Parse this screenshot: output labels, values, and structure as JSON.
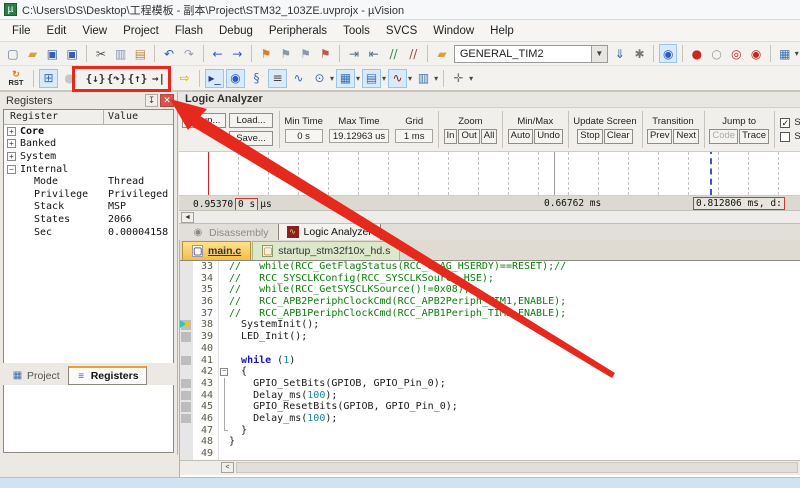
{
  "window": {
    "title": "C:\\Users\\DS\\Desktop\\工程模板 - 副本\\Project\\STM32_103ZE.uvprojx - µVision"
  },
  "menu": {
    "items": [
      "File",
      "Edit",
      "View",
      "Project",
      "Flash",
      "Debug",
      "Peripherals",
      "Tools",
      "SVCS",
      "Window",
      "Help"
    ]
  },
  "toolbar1": {
    "target_combo_value": "GENERAL_TIM2",
    "icons_a": [
      {
        "n": "new-file-icon",
        "g": "▢",
        "c": "#60789a"
      },
      {
        "n": "open-folder-icon",
        "g": "▰",
        "c": "#d9a33c"
      },
      {
        "n": "save-icon",
        "g": "▣",
        "c": "#3a5fae"
      },
      {
        "n": "save-all-icon",
        "g": "▣",
        "c": "#3a5fae",
        "sep": true
      },
      {
        "n": "cut-icon",
        "g": "✂",
        "c": "#555555"
      },
      {
        "n": "copy-icon",
        "g": "▥",
        "c": "#8a93b8"
      },
      {
        "n": "paste-icon",
        "g": "▤",
        "c": "#b08d4e",
        "sep": true
      },
      {
        "n": "undo-icon",
        "g": "↶",
        "c": "#2f58c8"
      },
      {
        "n": "redo-icon",
        "g": "↷",
        "c": "#98a0b0",
        "sep": true
      },
      {
        "n": "navigate-back-icon",
        "g": "←",
        "c": "#2f58c8"
      },
      {
        "n": "navigate-forward-icon",
        "g": "→",
        "c": "#2f58c8",
        "sep": true
      },
      {
        "n": "bookmark-icon",
        "g": "⚑",
        "c": "#e07a1e"
      },
      {
        "n": "bookmark-next-icon",
        "g": "⚑",
        "c": "#8a99aa"
      },
      {
        "n": "bookmark-prev-icon",
        "g": "⚑",
        "c": "#8a99aa"
      },
      {
        "n": "bookmark-clear-icon",
        "g": "⚑",
        "c": "#b85a4a",
        "sep": true
      },
      {
        "n": "indent-icon",
        "g": "⇥",
        "c": "#4a6a8a"
      },
      {
        "n": "outdent-icon",
        "g": "⇤",
        "c": "#4a6a8a"
      },
      {
        "n": "comment-icon",
        "g": "//",
        "c": "#3a8a4a"
      },
      {
        "n": "uncomment-icon",
        "g": "//",
        "c": "#a04a4a",
        "sep": true
      },
      {
        "n": "target-folder-icon",
        "g": "▰",
        "c": "#d9a33c"
      }
    ],
    "icons_b": [
      {
        "n": "flash-download-icon",
        "g": "⇓",
        "c": "#365f9e"
      },
      {
        "n": "target-options-icon",
        "g": "✱",
        "c": "#777777",
        "sep": true
      },
      {
        "n": "find-in-files-icon",
        "g": "◉",
        "c": "#2f58c8",
        "boxed": true,
        "sep": true
      },
      {
        "n": "breakpoint-icon",
        "g": "●",
        "c": "#c8281e"
      },
      {
        "n": "breakpoint-disabled-icon",
        "g": "○",
        "c": "#9a9a9a"
      },
      {
        "n": "kill-breakpoints-icon",
        "g": "◎",
        "c": "#c8281e"
      },
      {
        "n": "disable-breakpoints-icon",
        "g": "◉",
        "c": "#c8281e",
        "sep": true
      },
      {
        "n": "window-layout-icon",
        "g": "▦",
        "c": "#3a6fae",
        "caret": true
      }
    ]
  },
  "toolbar2": {
    "rst_label": "RST",
    "rst_glyph": "↻",
    "icons_pre": [
      {
        "n": "run-icon",
        "g": "⊞",
        "c": "#3a6fae",
        "boxed": true
      },
      {
        "n": "stop-icon",
        "g": "●",
        "c": "#aaaaaa",
        "disabled": true
      }
    ],
    "step_icons": [
      {
        "n": "step-into-icon",
        "g": "{↓}"
      },
      {
        "n": "step-over-icon",
        "g": "{↷}"
      },
      {
        "n": "step-out-icon",
        "g": "{↑}"
      },
      {
        "n": "run-to-cursor-icon",
        "g": "→|"
      }
    ],
    "next_statement": {
      "n": "show-next-statement-icon",
      "g": "⇨",
      "c": "#d8a800"
    },
    "icons_post": [
      {
        "n": "command-window-icon",
        "g": "▸_",
        "c": "#223a8a",
        "boxed": true
      },
      {
        "n": "disassembly-window-icon",
        "g": "◉",
        "c": "#2f58c8",
        "boxed": true
      },
      {
        "n": "symbols-window-icon",
        "g": "§",
        "c": "#3a6fae"
      },
      {
        "n": "registers-window-icon",
        "g": "≡",
        "c": "#444444",
        "boxed": true
      },
      {
        "n": "callstack-window-icon",
        "g": "∿",
        "c": "#3a6fae"
      },
      {
        "n": "watch-window-icon",
        "g": "⊙",
        "c": "#3a6fae",
        "caret": true
      },
      {
        "n": "memory-window-icon",
        "g": "▦",
        "c": "#3a6fae",
        "boxed": true,
        "caret": true
      },
      {
        "n": "serial-window-icon",
        "g": "▤",
        "c": "#3a6fae",
        "boxed": true,
        "caret": true
      },
      {
        "n": "analysis-window-icon",
        "g": "∿",
        "c": "#8a1f1f",
        "boxed": true,
        "caret": true
      },
      {
        "n": "system-viewer-icon",
        "g": "▥",
        "c": "#3a6fae",
        "caret": true,
        "sep": true
      },
      {
        "n": "toolbox-icon",
        "g": "✛",
        "c": "#777777",
        "caret": true
      }
    ]
  },
  "registers_panel": {
    "title": "Registers",
    "columns": [
      "Register",
      "Value"
    ],
    "rows": [
      {
        "label": "Core",
        "value": "",
        "level": 0,
        "expander": "+",
        "bold": true
      },
      {
        "label": "Banked",
        "value": "",
        "level": 0,
        "expander": "+"
      },
      {
        "label": "System",
        "value": "",
        "level": 0,
        "expander": "+"
      },
      {
        "label": "Internal",
        "value": "",
        "level": 0,
        "expander": "−"
      },
      {
        "label": "Mode",
        "value": "Thread",
        "level": 1
      },
      {
        "label": "Privilege",
        "value": "Privileged",
        "level": 1
      },
      {
        "label": "Stack",
        "value": "MSP",
        "level": 1
      },
      {
        "label": "States",
        "value": "2066",
        "level": 1
      },
      {
        "label": "Sec",
        "value": "0.00004158",
        "level": 1
      }
    ],
    "bottom_tabs": [
      {
        "label": "Project",
        "icon": "▦",
        "icon_color": "#3a6fae",
        "active": false
      },
      {
        "label": "Registers",
        "icon": "≡",
        "icon_color": "#3a6fae",
        "active": true
      }
    ]
  },
  "logic_analyzer": {
    "title": "Logic Analyzer",
    "file_buttons": [
      "Setup...",
      "Load...",
      "Save..."
    ],
    "value_groups": [
      {
        "label": "Min Time",
        "value": "0 s"
      },
      {
        "label": "Max Time",
        "value": "19.12963 us"
      },
      {
        "label": "Grid",
        "value": "1 ms"
      }
    ],
    "button_groups": [
      {
        "label": "Zoom",
        "buttons": [
          "In",
          "Out",
          "All"
        ]
      },
      {
        "label": "Min/Max",
        "buttons": [
          "Auto",
          "Undo"
        ]
      },
      {
        "label": "Update Screen",
        "buttons": [
          "Stop",
          "Clear"
        ]
      },
      {
        "label": "Transition",
        "buttons": [
          "Prev",
          "Next"
        ]
      },
      {
        "label": "Jump to",
        "buttons": [
          "Code",
          "Trace"
        ],
        "disabled": [
          "Code"
        ]
      }
    ],
    "checkboxes": [
      {
        "label": "Signal Info",
        "checked": true
      },
      {
        "label": "Show Cy",
        "checked": false
      }
    ],
    "timeline": {
      "left_value": "0.95370",
      "left_box": "0 s",
      "left_unit": "µs",
      "center_value": "0.66762 ms",
      "cursor_value": "0.812806 ms,  d:"
    },
    "dock_tabs": [
      {
        "label": "Disassembly",
        "active": false
      },
      {
        "label": "Logic Analyzer",
        "active": true
      }
    ]
  },
  "editor": {
    "tabs": [
      {
        "label": "main.c",
        "active": true
      },
      {
        "label": "startup_stm32f10x_hd.s",
        "active": false
      }
    ],
    "lines": [
      {
        "num": 33,
        "margin": false,
        "segs": [
          {
            "t": "//   while(RCC_GetFlagStatus(RCC_FLAG_HSERDY)==RESET);//",
            "c": "com"
          }
        ]
      },
      {
        "num": 34,
        "margin": false,
        "segs": [
          {
            "t": "//   RCC_SYSCLKConfig(RCC_SYSCLKSource_HSE);",
            "c": "com"
          }
        ]
      },
      {
        "num": 35,
        "margin": false,
        "segs": [
          {
            "t": "//   while(RCC_GetSYSCLKSource()!=0x08);",
            "c": "com"
          }
        ]
      },
      {
        "num": 36,
        "margin": false,
        "segs": [
          {
            "t": "//   RCC_APB2PeriphClockCmd(RCC_APB2Periph_TIM1,ENABLE);",
            "c": "com"
          }
        ]
      },
      {
        "num": 37,
        "margin": false,
        "segs": [
          {
            "t": "//   RCC_APB1PeriphClockCmd(RCC_APB1Periph_TIM2,ENABLE);",
            "c": "com"
          }
        ]
      },
      {
        "num": 38,
        "margin": true,
        "pc": true,
        "segs": [
          {
            "t": "  SystemInit();",
            "c": "pln"
          }
        ]
      },
      {
        "num": 39,
        "margin": true,
        "segs": [
          {
            "t": "  LED_Init();",
            "c": "pln"
          }
        ]
      },
      {
        "num": 40,
        "margin": false,
        "segs": []
      },
      {
        "num": 41,
        "margin": true,
        "segs": [
          {
            "t": "  ",
            "c": "pln"
          },
          {
            "t": "while",
            "c": "kw"
          },
          {
            "t": " (",
            "c": "pln"
          },
          {
            "t": "1",
            "c": "num"
          },
          {
            "t": ")",
            "c": "pln"
          }
        ]
      },
      {
        "num": 42,
        "margin": false,
        "fold": "box",
        "segs": [
          {
            "t": "  {",
            "c": "pln"
          }
        ]
      },
      {
        "num": 43,
        "margin": true,
        "fold": "line",
        "segs": [
          {
            "t": "    GPIO_SetBits(GPIOB, GPIO_Pin_0);",
            "c": "pln"
          }
        ]
      },
      {
        "num": 44,
        "margin": true,
        "fold": "line",
        "segs": [
          {
            "t": "    Delay_ms(",
            "c": "pln"
          },
          {
            "t": "100",
            "c": "num"
          },
          {
            "t": ");",
            "c": "pln"
          }
        ]
      },
      {
        "num": 45,
        "margin": true,
        "fold": "line",
        "segs": [
          {
            "t": "    GPIO_ResetBits(GPIOB, GPIO_Pin_0);",
            "c": "pln"
          }
        ]
      },
      {
        "num": 46,
        "margin": true,
        "fold": "line",
        "segs": [
          {
            "t": "    Delay_ms(",
            "c": "pln"
          },
          {
            "t": "100",
            "c": "num"
          },
          {
            "t": ");",
            "c": "pln"
          }
        ]
      },
      {
        "num": 47,
        "margin": false,
        "fold": "end",
        "segs": [
          {
            "t": "  }",
            "c": "pln"
          }
        ]
      },
      {
        "num": 48,
        "margin": false,
        "segs": [
          {
            "t": "}",
            "c": "pln"
          }
        ]
      },
      {
        "num": 49,
        "margin": false,
        "segs": []
      }
    ]
  },
  "annotation": {
    "color": "#e5291c"
  }
}
